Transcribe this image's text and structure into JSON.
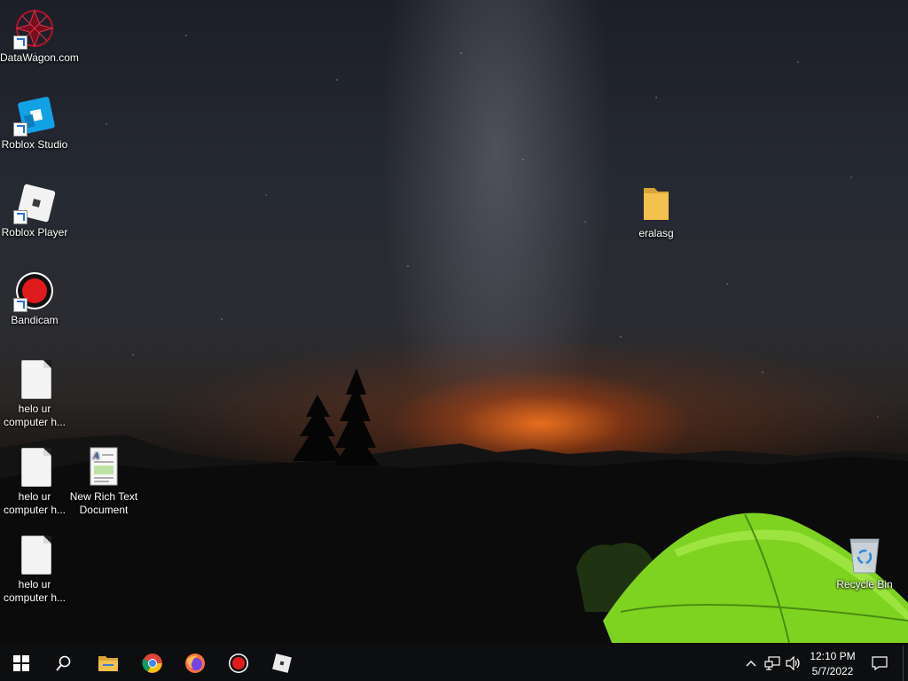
{
  "desktop": {
    "icons": [
      {
        "id": "datawagon",
        "label": "DataWagon.com",
        "icon": "datawagon-logo-icon",
        "shortcut": true
      },
      {
        "id": "roblox-studio",
        "label": "Roblox Studio",
        "icon": "roblox-studio-icon",
        "shortcut": true
      },
      {
        "id": "roblox-player",
        "label": "Roblox Player",
        "icon": "roblox-player-icon",
        "shortcut": true
      },
      {
        "id": "bandicam",
        "label": "Bandicam",
        "icon": "bandicam-icon",
        "shortcut": true
      },
      {
        "id": "txt1",
        "label": "helo ur computer h...",
        "icon": "text-file-icon",
        "shortcut": false
      },
      {
        "id": "txt2",
        "label": "helo ur computer h...",
        "icon": "text-file-icon",
        "shortcut": false
      },
      {
        "id": "rtf",
        "label": "New Rich Text Document",
        "icon": "rich-text-document-icon",
        "shortcut": false
      },
      {
        "id": "txt3",
        "label": "helo ur computer h...",
        "icon": "text-file-icon",
        "shortcut": false
      },
      {
        "id": "folder",
        "label": "eralasg",
        "icon": "folder-icon",
        "shortcut": false
      },
      {
        "id": "recycle",
        "label": "Recycle Bin",
        "icon": "recycle-bin-icon",
        "shortcut": false
      }
    ]
  },
  "taskbar": {
    "pinned": [
      "start-icon",
      "search-icon",
      "file-explorer-icon",
      "chrome-icon",
      "firefox-icon",
      "bandicam-icon",
      "roblox-icon"
    ],
    "tray": {
      "time": "12:10 PM",
      "date": "5/7/2022",
      "icons": [
        "chevron-up-icon",
        "network-icon",
        "volume-icon",
        "notification-icon"
      ]
    }
  },
  "colors": {
    "taskbar_bg": "#0d0e10",
    "tent_green": "#7ed321",
    "folder_yellow": "#f2c14e",
    "bandicam_red": "#e01b1b"
  }
}
